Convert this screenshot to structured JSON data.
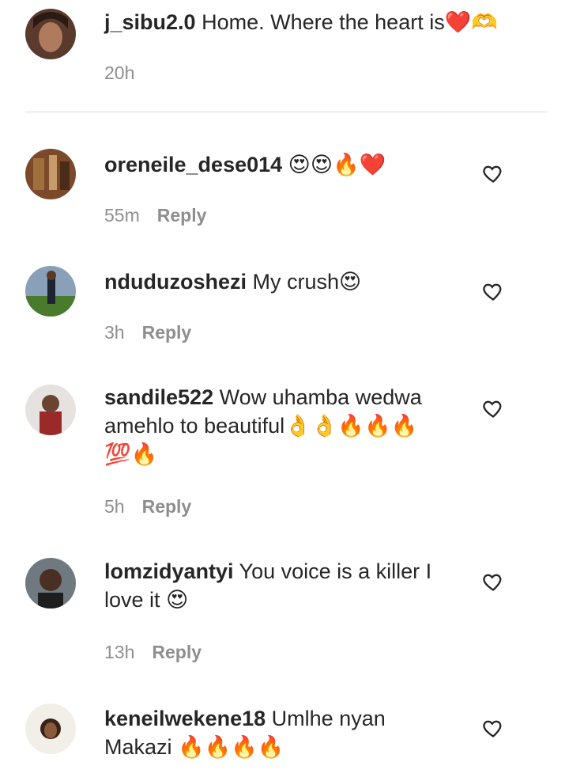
{
  "caption": {
    "username": "j_sibu2.0",
    "text": "Home. Where the heart is",
    "emojis": "❤️🫶",
    "time": "20h"
  },
  "reply_label": "Reply",
  "comments": [
    {
      "username": "oreneile_dese014",
      "text": "",
      "emojis": "😍😍🔥❤️",
      "time": "55m"
    },
    {
      "username": "nduduzoshezi",
      "text": "My crush",
      "emojis": "😍",
      "time": "3h"
    },
    {
      "username": "sandile522",
      "text": "Wow uhamba wedwa",
      "text2": "amehlo to beautiful",
      "emojis2": "👌👌🔥🔥🔥",
      "text3": "💯🔥",
      "time": "5h"
    },
    {
      "username": "lomzidyantyi",
      "text": "You voice is a killer I",
      "text2": "love it",
      "emojis2": "😍",
      "time": "13h"
    },
    {
      "username": "keneilwekene18",
      "text": "Umlhe nyan",
      "text2": "Makazi",
      "emojis2": "🔥🔥🔥🔥",
      "time": ""
    }
  ],
  "icons": {
    "like": "heart-outline-icon",
    "caption_emoji": "heart-hands-icon"
  }
}
